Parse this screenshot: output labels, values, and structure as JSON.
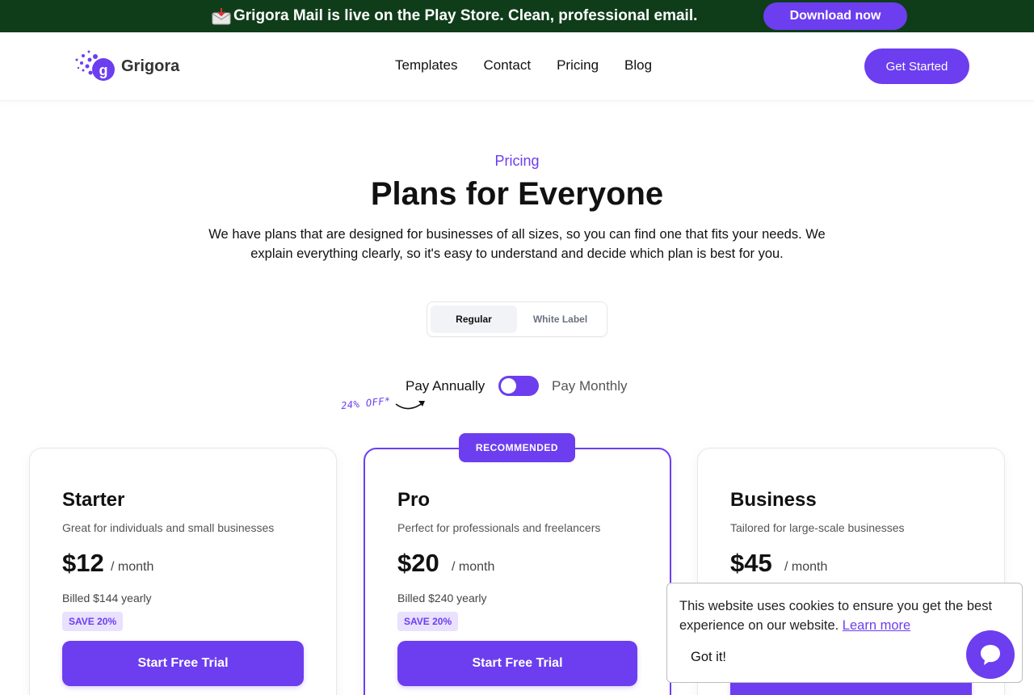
{
  "banner": {
    "icon": "incoming-mail-envelope-icon",
    "text": "Grigora Mail is live on the Play Store. Clean, professional email.",
    "button_label": "Download now",
    "background": "#0f3d1a"
  },
  "nav": {
    "logo_text": "Grigora",
    "links": [
      "Templates",
      "Contact",
      "Pricing",
      "Blog"
    ],
    "cta_label": "Get Started"
  },
  "hero": {
    "eyebrow": "Pricing",
    "title": "Plans for Everyone",
    "subtitle": "We have plans that are designed for businesses of all sizes, so you can find one that fits your needs. We explain everything clearly, so it's easy to understand and decide which plan is best for you."
  },
  "plan_type": {
    "options": [
      "Regular",
      "White Label"
    ],
    "selected": "Regular"
  },
  "billing": {
    "annual_label": "Pay Annually",
    "monthly_label": "Pay Monthly",
    "discount_note": "24% OFF*",
    "selected": "Pay Annually"
  },
  "plans": [
    {
      "name": "Starter",
      "description": "Great for individuals and small businesses",
      "price": "$12",
      "period": "/ month",
      "billed": "Billed $144 yearly",
      "save": "SAVE 20%",
      "cta": "Start Free Trial"
    },
    {
      "name": "Pro",
      "badge": "RECOMMENDED",
      "description": "Perfect for professionals and freelancers",
      "price": "$20",
      "period": "/ month",
      "billed": "Billed $240 yearly",
      "save": "SAVE 20%",
      "cta": "Start Free Trial"
    },
    {
      "name": "Business",
      "description": "Tailored for large-scale businesses",
      "price": "$45",
      "period": "/ month"
    }
  ],
  "cookie": {
    "message": "This website uses cookies to ensure you get the best experience on our website.",
    "link_label": "Learn more",
    "button_label": "Got it!"
  },
  "chat": {
    "icon": "chat-bubble-icon"
  },
  "colors": {
    "accent": "#6c3ef0",
    "save_bg": "#e9e1fd"
  }
}
